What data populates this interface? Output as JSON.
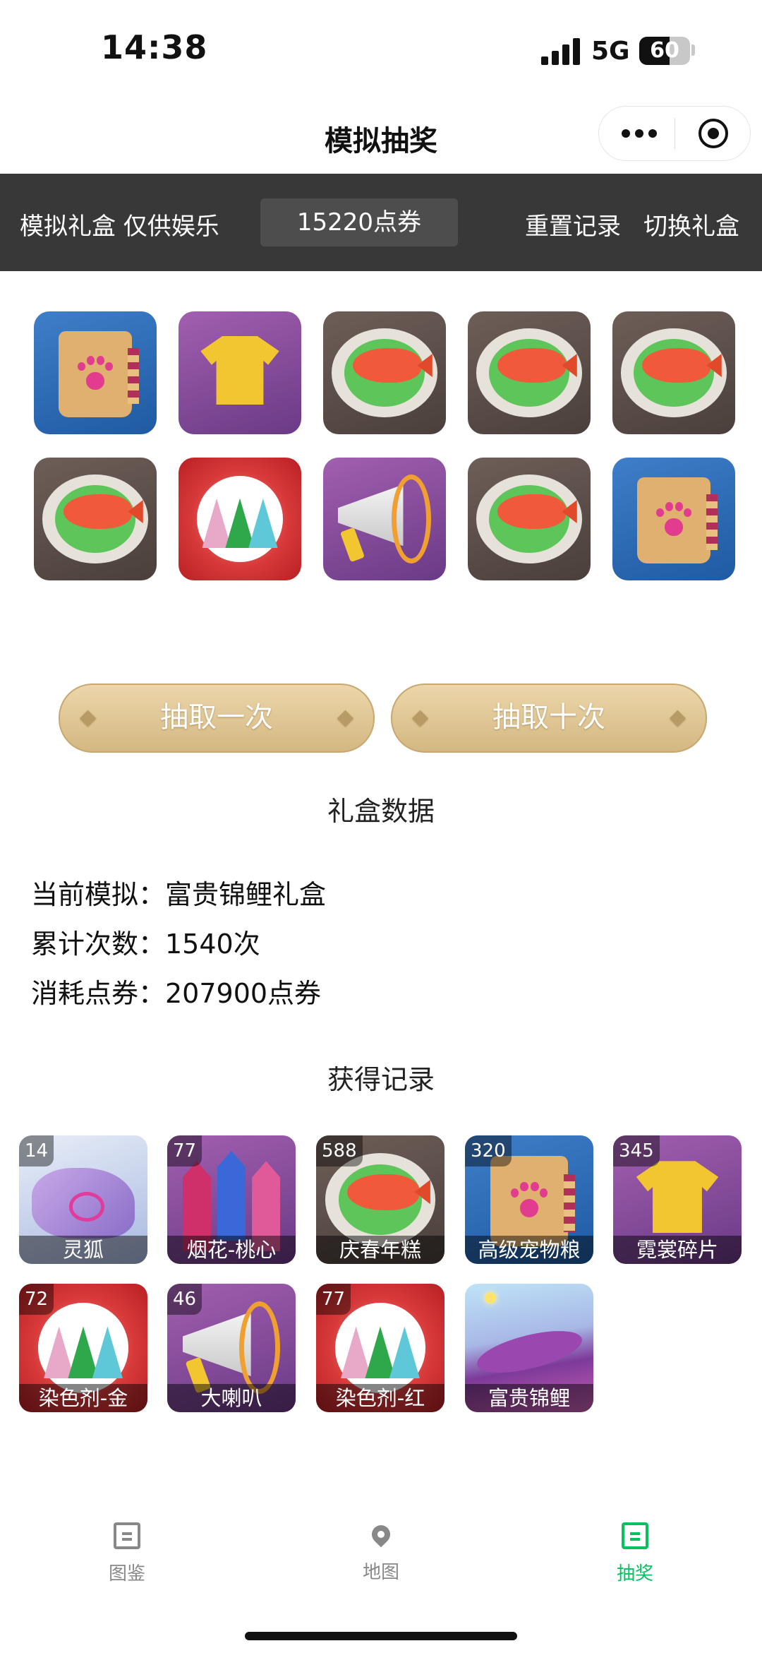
{
  "status_bar": {
    "time": "14:38",
    "network": "5G",
    "battery": "60",
    "battery_level": 0.6
  },
  "nav": {
    "title": "模拟抽奖",
    "more_icon": "more-dots-icon",
    "close_icon": "record-target-icon"
  },
  "topbar": {
    "label": "模拟礼盒 仅供娱乐",
    "points": "15220点券",
    "reset_label": "重置记录",
    "switch_label": "切换礼盒"
  },
  "prizes": [
    {
      "icon": "pet-food-bag-icon"
    },
    {
      "icon": "golden-shirt-icon"
    },
    {
      "icon": "koi-cake-plate-icon"
    },
    {
      "icon": "koi-cake-plate-icon"
    },
    {
      "icon": "koi-cake-plate-icon"
    },
    {
      "icon": "koi-cake-plate-icon"
    },
    {
      "icon": "dye-bottles-icon"
    },
    {
      "icon": "megaphone-icon"
    },
    {
      "icon": "koi-cake-plate-icon"
    },
    {
      "icon": "pet-food-bag-icon"
    }
  ],
  "buttons": {
    "draw_once": "抽取一次",
    "draw_ten": "抽取十次"
  },
  "stats": {
    "section_title": "礼盒数据",
    "current": "当前模拟：富贵锦鲤礼盒",
    "total": "累计次数：1540次",
    "cost": "消耗点券：207900点券"
  },
  "records": {
    "section_title": "获得记录",
    "items": [
      {
        "count": "14",
        "name": "灵狐",
        "icon": "spirit-fox-icon"
      },
      {
        "count": "77",
        "name": "烟花-桃心",
        "icon": "fireworks-icon"
      },
      {
        "count": "588",
        "name": "庆春年糕",
        "icon": "koi-cake-plate-icon"
      },
      {
        "count": "320",
        "name": "高级宠物粮",
        "icon": "pet-food-bag-icon"
      },
      {
        "count": "345",
        "name": "霓裳碎片",
        "icon": "golden-shirt-icon"
      },
      {
        "count": "72",
        "name": "染色剂-金",
        "icon": "dye-bottles-icon"
      },
      {
        "count": "46",
        "name": "大喇叭",
        "icon": "megaphone-icon"
      },
      {
        "count": "77",
        "name": "染色剂-红",
        "icon": "dye-bottles-icon"
      },
      {
        "count": "",
        "name": "富贵锦鲤",
        "icon": "koi-outfit-icon"
      }
    ]
  },
  "tabbar": {
    "items": [
      {
        "label": "图鉴",
        "icon": "book-icon",
        "active": false
      },
      {
        "label": "地图",
        "icon": "map-pin-icon",
        "active": false
      },
      {
        "label": "抽奖",
        "icon": "lottery-icon",
        "active": true
      }
    ],
    "active_color": "#07c160"
  },
  "colors": {
    "topbar_bg": "#383838",
    "button_gold": "#d4b882"
  }
}
